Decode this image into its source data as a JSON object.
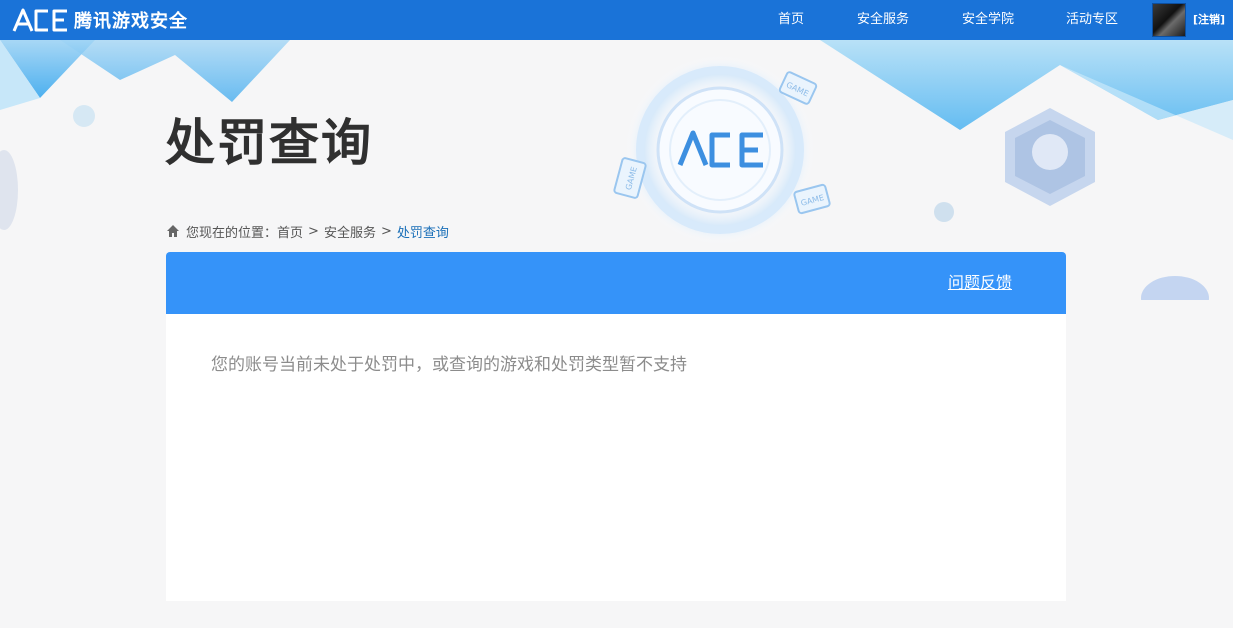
{
  "header": {
    "brand": "腾讯游戏安全",
    "nav": [
      {
        "label": "首页"
      },
      {
        "label": "安全服务"
      },
      {
        "label": "安全学院"
      },
      {
        "label": "活动专区"
      }
    ],
    "logout": "[注销]"
  },
  "hero": {
    "title": "处罚查询",
    "badge_text": "GAME"
  },
  "breadcrumb": {
    "prefix": "您现在的位置：",
    "items": [
      "首页",
      "安全服务"
    ],
    "separator": ">",
    "current": "处罚查询"
  },
  "panel": {
    "feedback": "问题反馈",
    "message": "您的账号当前未处于处罚中，或查询的游戏和处罚类型暂不支持"
  },
  "colors": {
    "topbar": "#1a73d8",
    "panel_header": "#3593f9",
    "accent_link": "#1a6fb8"
  }
}
